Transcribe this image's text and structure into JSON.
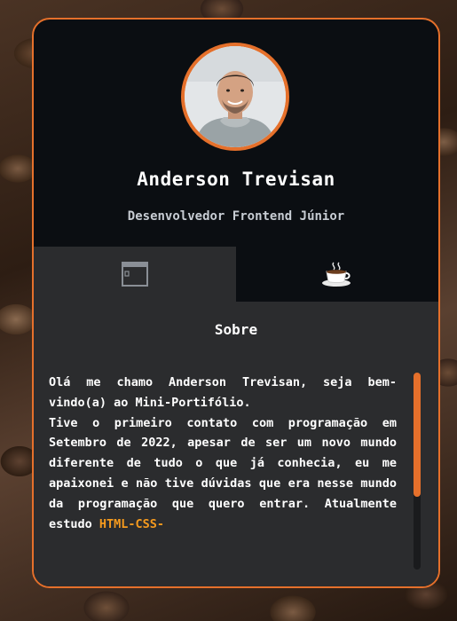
{
  "profile": {
    "name": "Anderson Trevisan",
    "role": "Desenvolvedor Frontend Júnior"
  },
  "tabs": [
    {
      "icon": "browser-window-icon",
      "active": true
    },
    {
      "icon": "coffee-cup-icon",
      "active": false
    }
  ],
  "about": {
    "title": "Sobre",
    "paragraph1": "Olá me chamo Anderson Trevisan, seja bem-vindo(a) ao Mini-Portifólio.",
    "paragraph2_start": "Tive o primeiro contato com programação em Setembro de 2022, apesar de ser um novo mundo diferente de tudo o que já conhecia, eu me apaixonei e não tive dúvidas que era nesse mundo da programação que quero entrar. Atualmente estudo ",
    "highlight": "HTML-CSS-"
  },
  "colors": {
    "accent": "#e5702b",
    "card_bg": "#0b0e12",
    "panel_bg": "#2b2c2e",
    "highlight": "#f59a1e"
  }
}
